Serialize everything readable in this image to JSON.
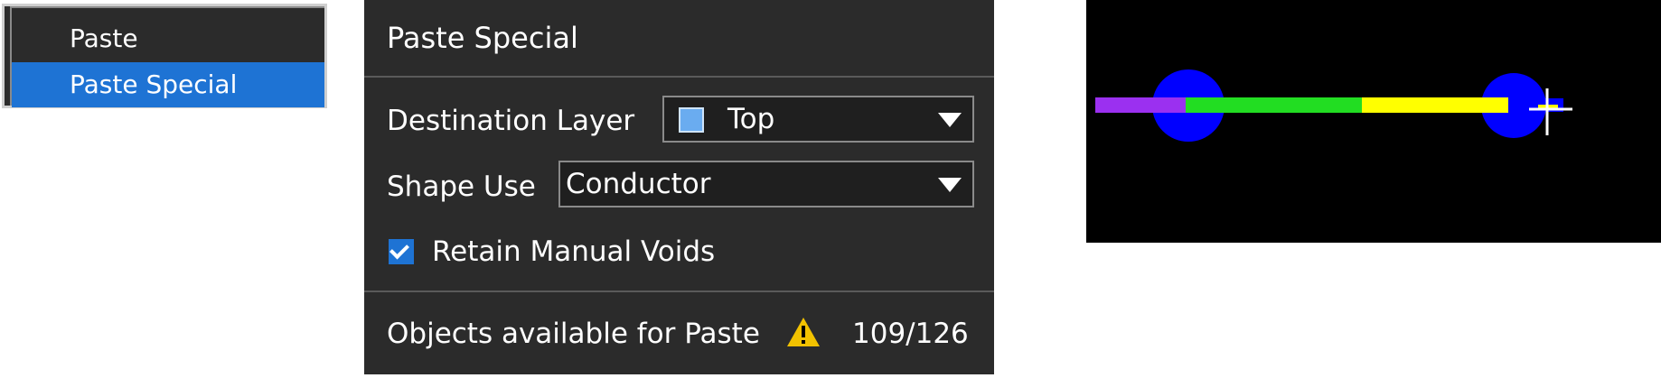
{
  "context_menu": {
    "items": [
      {
        "label": "Paste"
      },
      {
        "label": "Paste Special"
      }
    ]
  },
  "dialog": {
    "title": "Paste Special",
    "destination_layer": {
      "label": "Destination Layer",
      "value": "Top",
      "swatch_color": "#6aacf0"
    },
    "shape_use": {
      "label": "Shape Use",
      "value": "Conductor"
    },
    "retain_manual_voids": {
      "label": "Retain Manual Voids",
      "checked": true
    },
    "objects_available": {
      "label": "Objects available for Paste",
      "count": "109/126"
    }
  },
  "preview": {
    "colors": {
      "background": "#000000",
      "pad": "#0000ff",
      "track_purple": "#9b30f0",
      "track_green": "#22dd22",
      "track_yellow": "#ffff00",
      "cursor": "#ffffff"
    }
  },
  "colors": {
    "panel_bg": "#2b2b2b",
    "accent": "#1e73d4",
    "warning": "#f2c200"
  }
}
